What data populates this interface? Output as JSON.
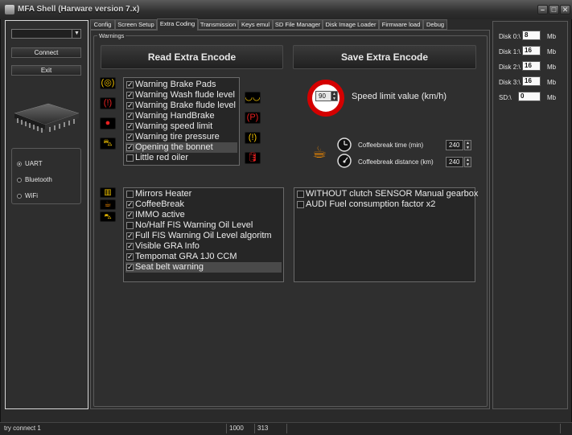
{
  "window": {
    "title": "MFA Shell (Harware version 7.x)",
    "minimize": "–",
    "maximize": "□",
    "close": "✕"
  },
  "left_panel": {
    "port_value": "",
    "connect_label": "Connect",
    "exit_label": "Exit",
    "connections": [
      {
        "label": "UART",
        "selected": true
      },
      {
        "label": "Bluetooth",
        "selected": false
      },
      {
        "label": "WiFi",
        "selected": false
      }
    ]
  },
  "tabs": [
    {
      "label": "Config",
      "active": false
    },
    {
      "label": "Screen Setup",
      "active": false
    },
    {
      "label": "Extra Coding",
      "active": true
    },
    {
      "label": "Transmission",
      "active": false
    },
    {
      "label": "Keys emul",
      "active": false
    },
    {
      "label": "SD File Manager",
      "active": false
    },
    {
      "label": "Disk Image Loader",
      "active": false
    },
    {
      "label": "Firmware load",
      "active": false
    },
    {
      "label": "Debug",
      "active": false
    }
  ],
  "warnings_group": {
    "title": "Warnings",
    "read_label": "Read Extra Encode",
    "save_label": "Save Extra Encode",
    "warning_list": [
      {
        "label": "Warning Brake Pads",
        "checked": true
      },
      {
        "label": "Warning Wash flude level",
        "checked": true
      },
      {
        "label": "Warning Brake flude level",
        "checked": true
      },
      {
        "label": "Warning HandBrake",
        "checked": true
      },
      {
        "label": "Warning speed limit",
        "checked": true
      },
      {
        "label": "Warning tire pressure",
        "checked": true
      },
      {
        "label": "Opening the bonnet",
        "checked": true,
        "selected": true
      },
      {
        "label": "Little red oiler",
        "checked": false
      }
    ],
    "speed_limit": {
      "value": "90",
      "label": "Speed limit value (km/h)"
    },
    "coffeebreak": {
      "time_label": "Coffeebreak time (min)",
      "time_value": "240",
      "distance_label": "Coffeebreak distance (km)",
      "distance_value": "240"
    },
    "options_list": [
      {
        "label": "Mirrors Heater",
        "checked": false
      },
      {
        "label": "CoffeeBreak",
        "checked": true
      },
      {
        "label": "IMMO active",
        "checked": true
      },
      {
        "label": "No/Half FIS Warning Oil Level",
        "checked": false
      },
      {
        "label": "Full FIS Warning Oil Level algoritm",
        "checked": true
      },
      {
        "label": "Visible GRA Info",
        "checked": true
      },
      {
        "label": "Tempomat GRA 1J0 CCM",
        "checked": true
      },
      {
        "label": "Seat belt warning",
        "checked": true,
        "selected": true
      }
    ],
    "gearbox_list": [
      {
        "label": "WITHOUT clutch SENSOR Manual gearbox",
        "checked": false
      },
      {
        "label": "AUDI Fuel consumption factor x2",
        "checked": false
      }
    ]
  },
  "disks": [
    {
      "label": "Disk 0:\\",
      "value": "8",
      "unit": "Mb"
    },
    {
      "label": "Disk 1:\\",
      "value": "16",
      "unit": "Mb"
    },
    {
      "label": "Disk 2:\\",
      "value": "16",
      "unit": "Mb"
    },
    {
      "label": "Disk 3:\\",
      "value": "16",
      "unit": "Mb"
    },
    {
      "label": "SD:\\",
      "value": "0",
      "unit": "Mb"
    }
  ],
  "status_bar": {
    "message": "try connect 1",
    "value1": "1000",
    "value2": "313"
  },
  "colors": {
    "warning_yellow": "#f2c200",
    "warning_red": "#e82020",
    "sign_red": "#d40000"
  },
  "icons": {
    "brake_pads": "brake-pads-icon",
    "wash_fluid": "wash-fluid-icon",
    "brake_fluid": "brake-fluid-icon",
    "handbrake": "handbrake-icon",
    "speed_limit": "speed-limit-icon",
    "tire_pressure": "tire-pressure-icon",
    "bonnet": "bonnet-icon",
    "oiler": "oiler-icon",
    "coffee": "coffee-icon",
    "clock": "clock-icon",
    "speedometer": "speedometer-icon",
    "chip": "chip-icon"
  }
}
